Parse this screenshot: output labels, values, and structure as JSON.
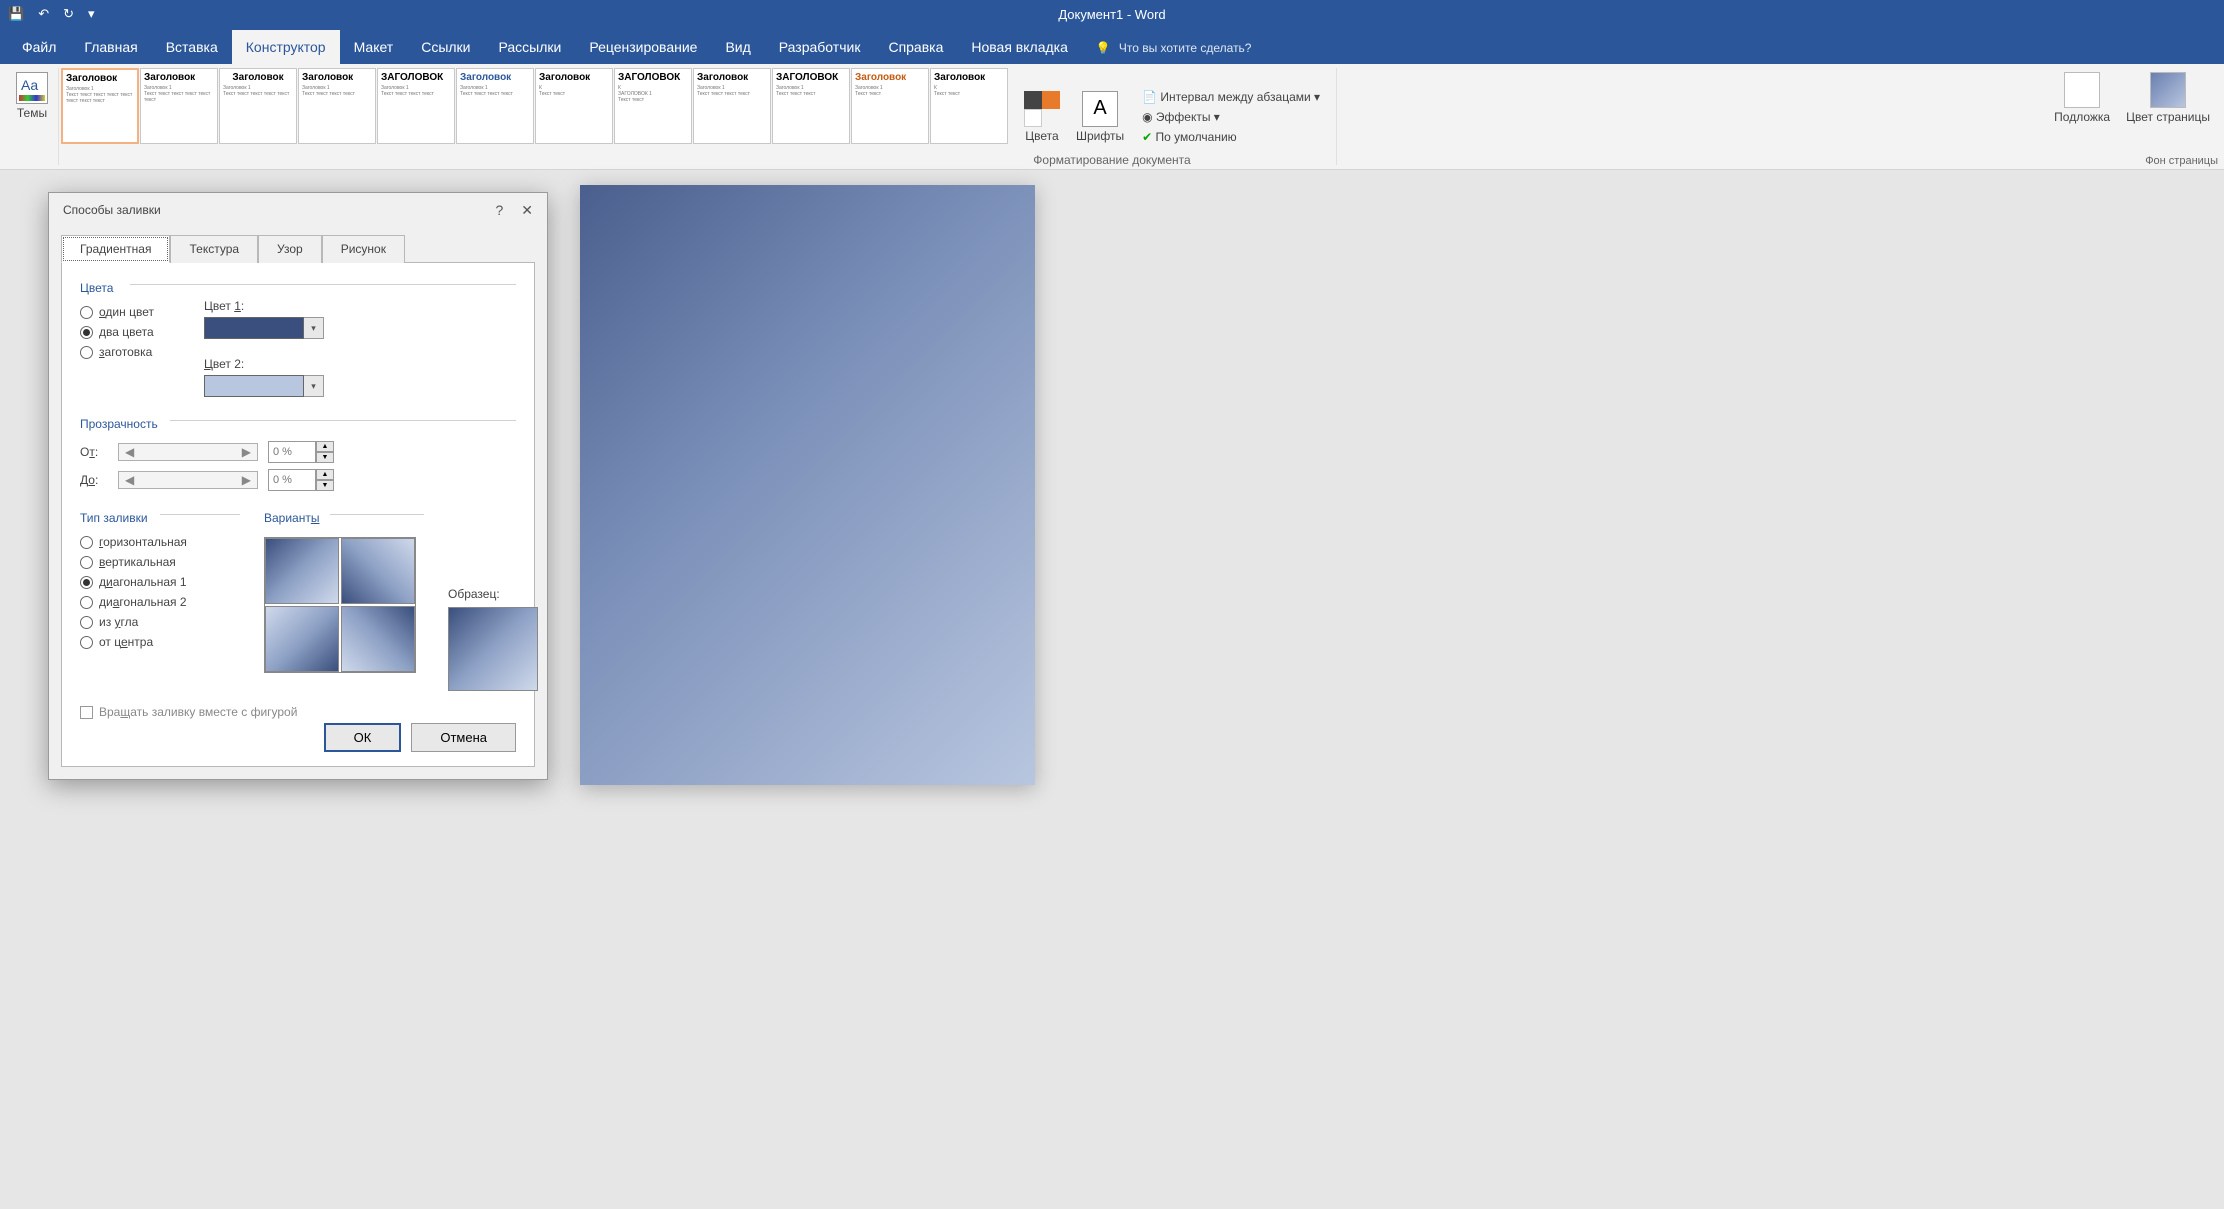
{
  "app": {
    "title": "Документ1 - Word"
  },
  "qat": {
    "save": "💾",
    "undo": "↶",
    "redo": "↻",
    "more": "▾"
  },
  "tabs": {
    "file": "Файл",
    "home": "Главная",
    "insert": "Вставка",
    "design": "Конструктор",
    "layout": "Макет",
    "references": "Ссылки",
    "mailings": "Рассылки",
    "review": "Рецензирование",
    "view": "Вид",
    "developer": "Разработчик",
    "help": "Справка",
    "new_tab": "Новая вкладка",
    "tell_me": "Что вы хотите сделать?"
  },
  "ribbon": {
    "themes": "Темы",
    "colors": "Цвета",
    "fonts": "Шрифты",
    "spacing": "Интервал между абзацами ▾",
    "effects": "Эффекты ▾",
    "default": "По умолчанию",
    "watermark": "Подложка",
    "page_color": "Цвет страницы",
    "doc_formatting": "Форматирование документа",
    "page_bg": "Фон страницы",
    "style_head": "Заголовок",
    "style_sub": "Заголовок 1",
    "style_upper": "ЗАГОЛОВОК"
  },
  "dialog": {
    "title": "Способы заливки",
    "help": "?",
    "close": "✕",
    "tabs": {
      "gradient": "Градиентная",
      "texture": "Текстура",
      "pattern": "Узор",
      "picture": "Рисунок"
    },
    "colors_group": "Цвета",
    "one_color": "один цвет",
    "two_colors": "два цвета",
    "preset": "заготовка",
    "color1": "Цвет 1:",
    "color2": "Цвет 2:",
    "transparency": "Прозрачность",
    "from": "От:",
    "to": "До:",
    "pct": "0 %",
    "fill_type": "Тип заливки",
    "variants": "Варианты",
    "sample": "Образец:",
    "horizontal": "горизонтальная",
    "vertical": "вертикальная",
    "diag1": "диагональная 1",
    "diag2": "диагональная 2",
    "from_corner": "из угла",
    "from_center": "от центра",
    "rotate": "Вращать заливку вместе с фигурой",
    "ok": "ОК",
    "cancel": "Отмена",
    "color1_val": "#3a4f7d",
    "color2_val": "#b8c6df"
  }
}
